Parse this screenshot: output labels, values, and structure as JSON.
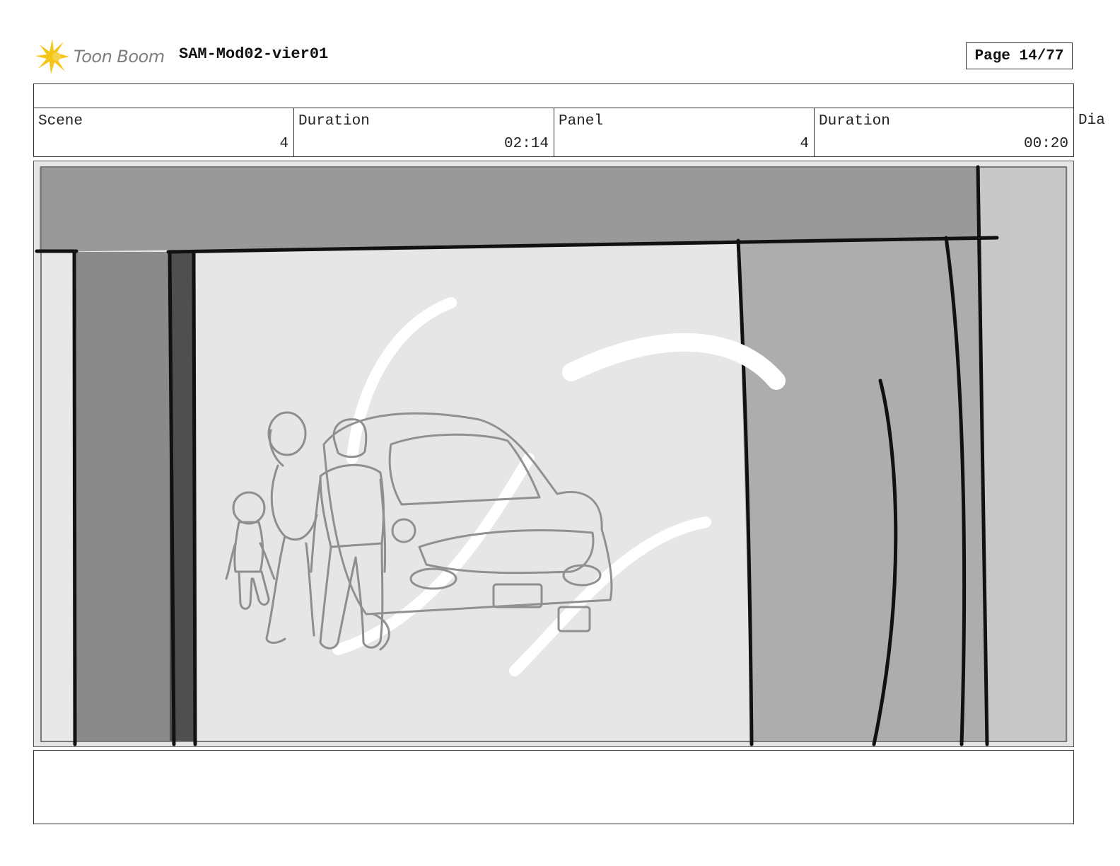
{
  "header": {
    "logo_text": "Toon Boom",
    "project_title": "SAM-Mod02-vier01",
    "page_label": "Page 14/77"
  },
  "info": {
    "cells": [
      {
        "label": "Scene",
        "value": "4"
      },
      {
        "label": "Duration",
        "value": "02:14"
      },
      {
        "label": "Panel",
        "value": "4"
      },
      {
        "label": "Duration",
        "value": "00:20"
      }
    ],
    "overflow_label": "Dia"
  },
  "colors": {
    "logo_yellow": "#f5c518",
    "logo_gray": "#7d7d7d",
    "border": "#333333"
  },
  "icons": {
    "logo": "toon-boom-starburst-icon"
  }
}
